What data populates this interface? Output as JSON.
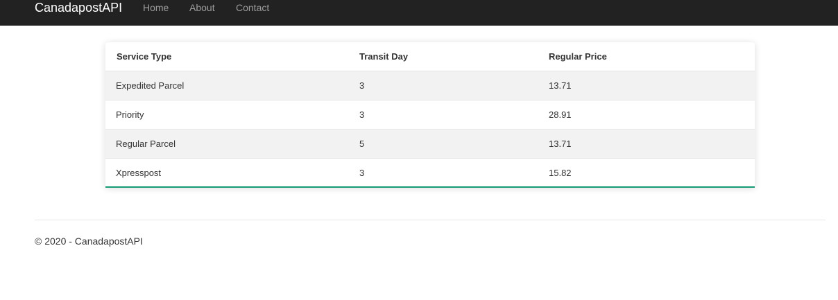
{
  "navbar": {
    "brand": "CanadapostAPI",
    "links": [
      {
        "label": "Home"
      },
      {
        "label": "About"
      },
      {
        "label": "Contact"
      }
    ]
  },
  "table": {
    "headers": [
      "Service Type",
      "Transit Day",
      "Regular Price"
    ],
    "rows": [
      [
        "Expedited Parcel",
        "3",
        "13.71"
      ],
      [
        "Priority",
        "3",
        "28.91"
      ],
      [
        "Regular Parcel",
        "5",
        "13.71"
      ],
      [
        "Xpresspost",
        "3",
        "15.82"
      ]
    ],
    "accent_color": "#159a76"
  },
  "footer": {
    "text": "© 2020 - CanadapostAPI"
  }
}
